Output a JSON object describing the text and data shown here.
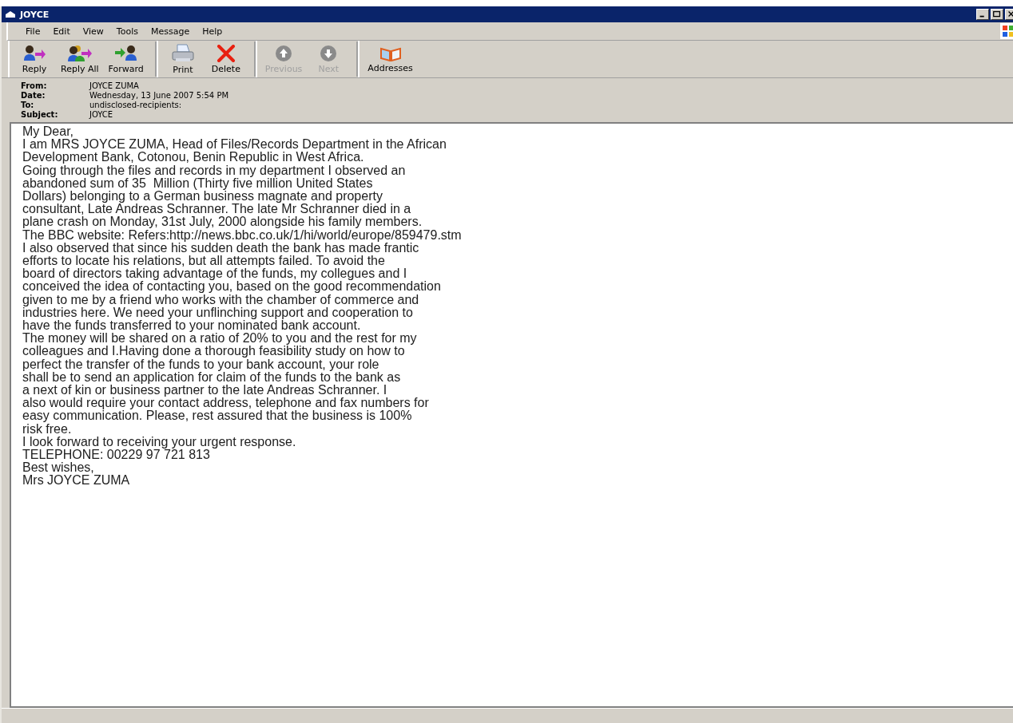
{
  "window": {
    "title": "JOYCE"
  },
  "menu": [
    "File",
    "Edit",
    "View",
    "Tools",
    "Message",
    "Help"
  ],
  "toolbar": [
    [
      {
        "kind": "reply",
        "label": "Reply",
        "disabled": false
      },
      {
        "kind": "reply_all",
        "label": "Reply All",
        "disabled": false
      },
      {
        "kind": "forward",
        "label": "Forward",
        "disabled": false
      }
    ],
    [
      {
        "kind": "print",
        "label": "Print",
        "disabled": false
      },
      {
        "kind": "delete",
        "label": "Delete",
        "disabled": false
      }
    ],
    [
      {
        "kind": "previous",
        "label": "Previous",
        "disabled": true
      },
      {
        "kind": "next",
        "label": "Next",
        "disabled": true
      }
    ],
    [
      {
        "kind": "addresses",
        "label": "Addresses",
        "disabled": false
      }
    ]
  ],
  "header": [
    {
      "label": "From:",
      "value": "JOYCE ZUMA"
    },
    {
      "label": "Date:",
      "value": "Wednesday, 13 June 2007 5:54 PM"
    },
    {
      "label": "To:",
      "value": "undisclosed-recipients:"
    },
    {
      "label": "Subject:",
      "value": "JOYCE"
    }
  ],
  "body": [
    "My Dear,",
    "I am MRS JOYCE ZUMA, Head of Files/Records Department in the African",
    "Development Bank, Cotonou, Benin Republic in West Africa.",
    "Going through the files and records in my department I observed an",
    "abandoned sum of 35  Million (Thirty five million United States",
    "Dollars) belonging to a German business magnate and property",
    "consultant, Late Andreas Schranner. The late Mr Schranner died in a",
    "plane crash on Monday, 31st July, 2000 alongside his family members.",
    "The BBC website: Refers:http://news.bbc.co.uk/1/hi/world/europe/859479.stm",
    "I also observed that since his sudden death the bank has made frantic",
    "efforts to locate his relations, but all attempts failed. To avoid the",
    "board of directors taking advantage of the funds, my collegues and I",
    "conceived the idea of contacting you, based on the good recommendation",
    "given to me by a friend who works with the chamber of commerce and",
    "industries here. We need your unflinching support and cooperation to",
    "have the funds transferred to your nominated bank account.",
    "The money will be shared on a ratio of 20% to you and the rest for my",
    "colleagues and I.Having done a thorough feasibility study on how to",
    "perfect the transfer of the funds to your bank account, your role",
    "shall be to send an application for claim of the funds to the bank as",
    "a next of kin or business partner to the late Andreas Schranner. I",
    "also would require your contact address, telephone and fax numbers for",
    "easy communication. Please, rest assured that the business is 100%",
    "risk free.",
    "I look forward to receiving your urgent response.",
    "TELEPHONE: 00229 97 721 813",
    "Best wishes,",
    "Mrs JOYCE ZUMA"
  ]
}
